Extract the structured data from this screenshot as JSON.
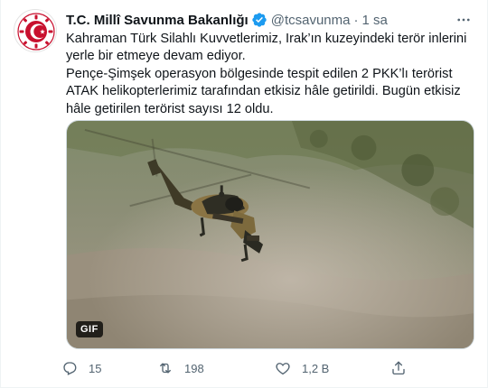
{
  "tweet": {
    "author_name": "T.C. Millî Savunma Bakanlığı",
    "handle": "@tcsavunma",
    "separator": "·",
    "time": "1 sa",
    "paragraphs": [
      "Kahraman Türk Silahlı Kuvvetlerimiz, Irak’ın kuzeyindeki terör inlerini yerle bir etmeye devam ediyor.",
      "Pençe-Şimşek operasyon bölgesinde tespit edilen 2 PKK’lı terörist ATAK helikopterlerimiz tarafından etkisiz hâle getirildi. Bugün etkisiz hâle getirilen terörist sayısı 12 oldu."
    ],
    "media": {
      "badge": "GIF",
      "subject": "attack helicopter flying low over rocky hillside"
    },
    "actions": {
      "reply_count": "15",
      "retweet_count": "198",
      "like_count": "1,2 B"
    }
  },
  "icons": {
    "verified": "verified-badge-icon",
    "more": "more-options-icon",
    "reply": "reply-icon",
    "retweet": "retweet-icon",
    "like": "like-icon",
    "share": "share-icon"
  },
  "colors": {
    "verified_blue": "#1d9bf0",
    "text_primary": "#0f1419",
    "text_secondary": "#536471",
    "avatar_red": "#c8102e"
  }
}
